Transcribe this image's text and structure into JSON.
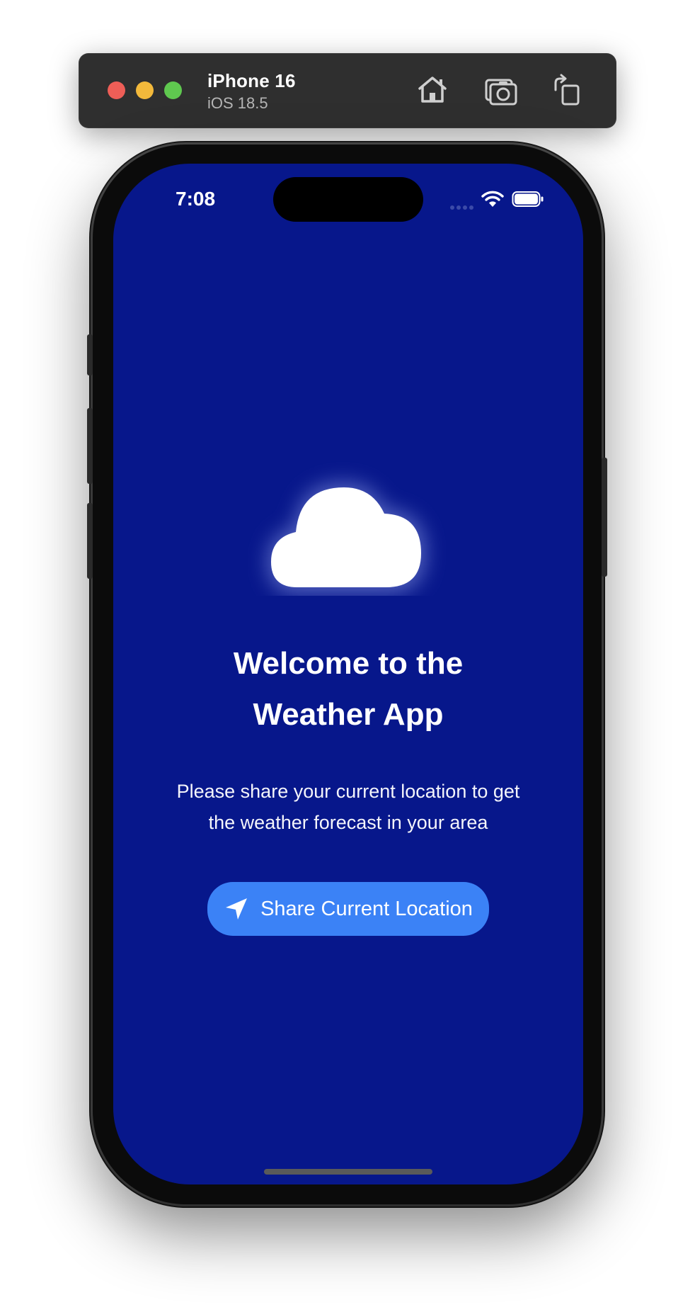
{
  "simulator": {
    "device_name": "iPhone 16",
    "os_version": "iOS 18.5",
    "icons": [
      "home-icon",
      "screenshot-icon",
      "rotate-icon"
    ]
  },
  "status_bar": {
    "time": "7:08",
    "icons": [
      "cellular-signal-icon",
      "wifi-icon",
      "battery-icon"
    ]
  },
  "welcome": {
    "title_line1": "Welcome to the",
    "title_line2": "Weather App",
    "subtitle_line1": "Please share your current location to get",
    "subtitle_line2": "the weather forecast in your area",
    "hero_icon": "cloud-icon"
  },
  "share_button": {
    "label": "Share Current Location",
    "icon": "location-arrow-icon"
  },
  "colors": {
    "screen_background": "#07178b",
    "button_background": "#3b82f6",
    "text": "#ffffff"
  }
}
